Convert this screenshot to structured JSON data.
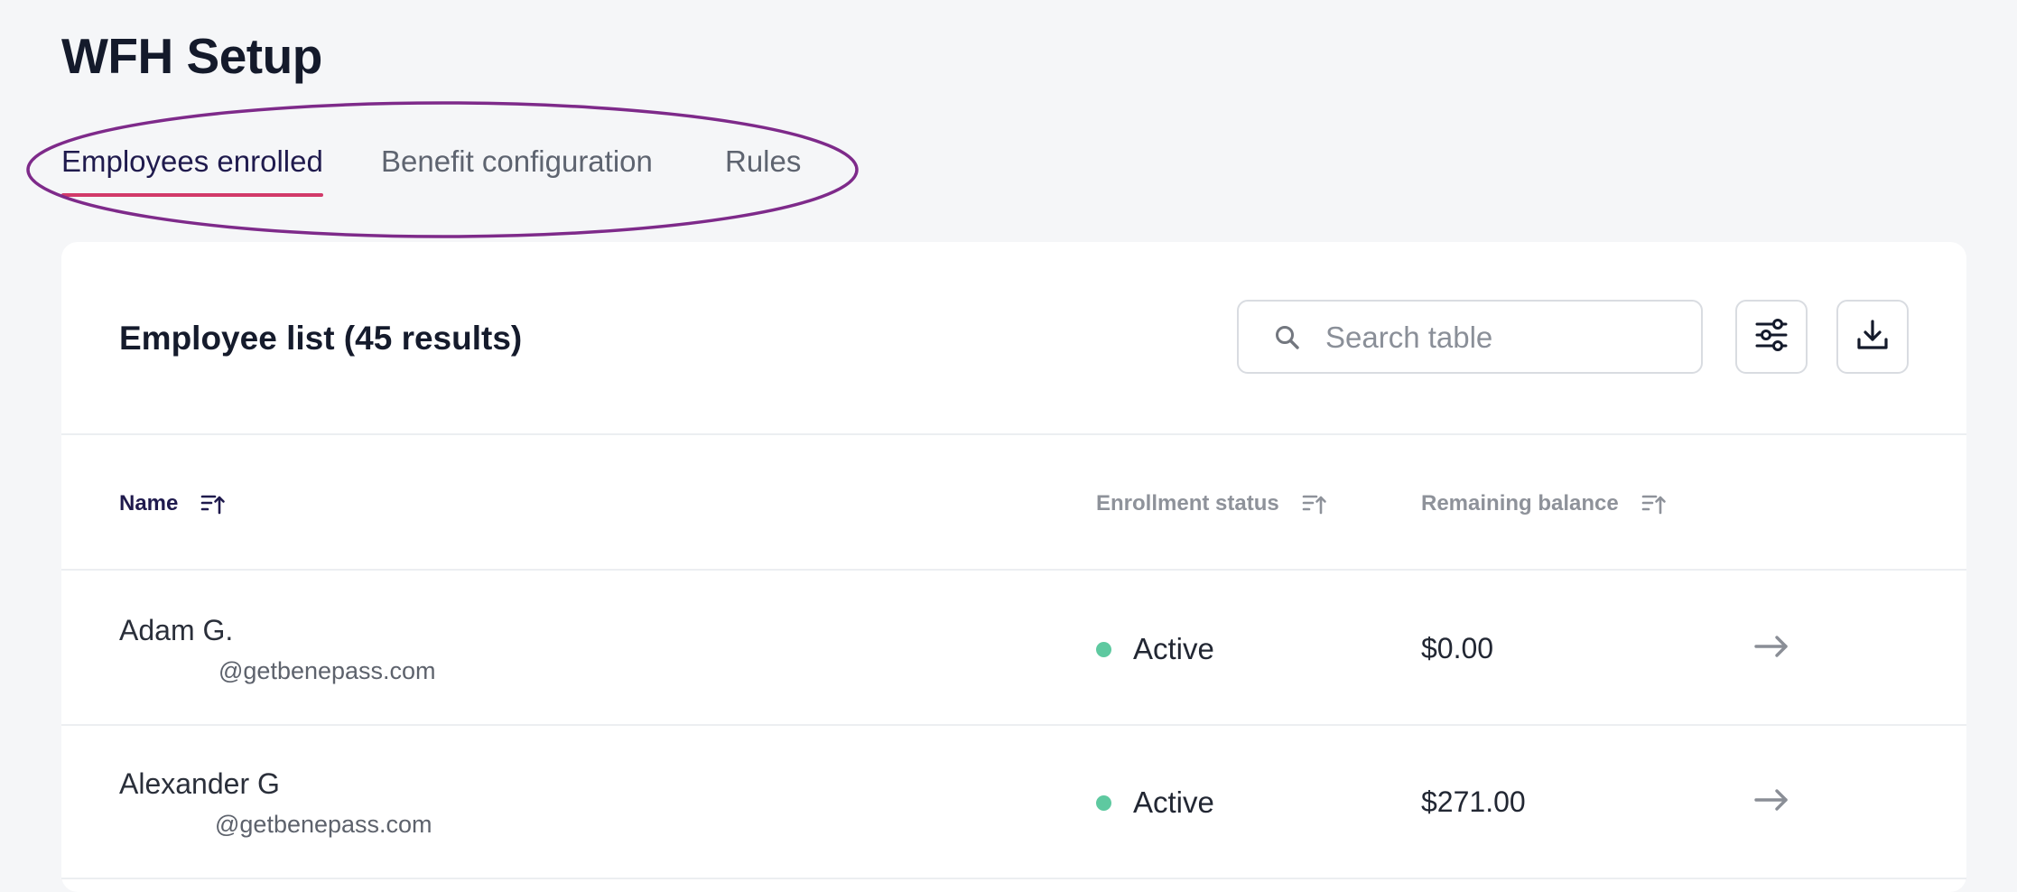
{
  "page": {
    "title": "WFH Setup"
  },
  "tabs": [
    {
      "label": "Employees enrolled",
      "active": true
    },
    {
      "label": "Benefit configuration",
      "active": false
    },
    {
      "label": "Rules",
      "active": false
    }
  ],
  "annotation": {
    "color": "#7e2a8a"
  },
  "card": {
    "title": "Employee list (45 results)",
    "search": {
      "placeholder": "Search table",
      "value": ""
    },
    "icons": {
      "search": "search-icon",
      "filter": "sliders-icon",
      "download": "download-icon"
    }
  },
  "table": {
    "columns": [
      {
        "label": "Name",
        "active": true,
        "sort_icon": "sort-ascending-icon"
      },
      {
        "label": "Enrollment status",
        "active": false,
        "sort_icon": "sort-ascending-icon"
      },
      {
        "label": "Remaining balance",
        "active": false,
        "sort_icon": "sort-ascending-icon"
      }
    ],
    "rows": [
      {
        "name": "Adam G.",
        "email": "@getbenepass.com",
        "status": "Active",
        "balance": "$0.00",
        "action_icon": "arrow-right-icon"
      },
      {
        "name": "Alexander G",
        "email": "@getbenepass.com",
        "status": "Active",
        "balance": "$271.00",
        "action_icon": "arrow-right-icon"
      }
    ]
  },
  "colors": {
    "active_tab_underline": "#d23a6a",
    "status_active": "#5ec9a0",
    "active_header": "#1f1a4d"
  }
}
